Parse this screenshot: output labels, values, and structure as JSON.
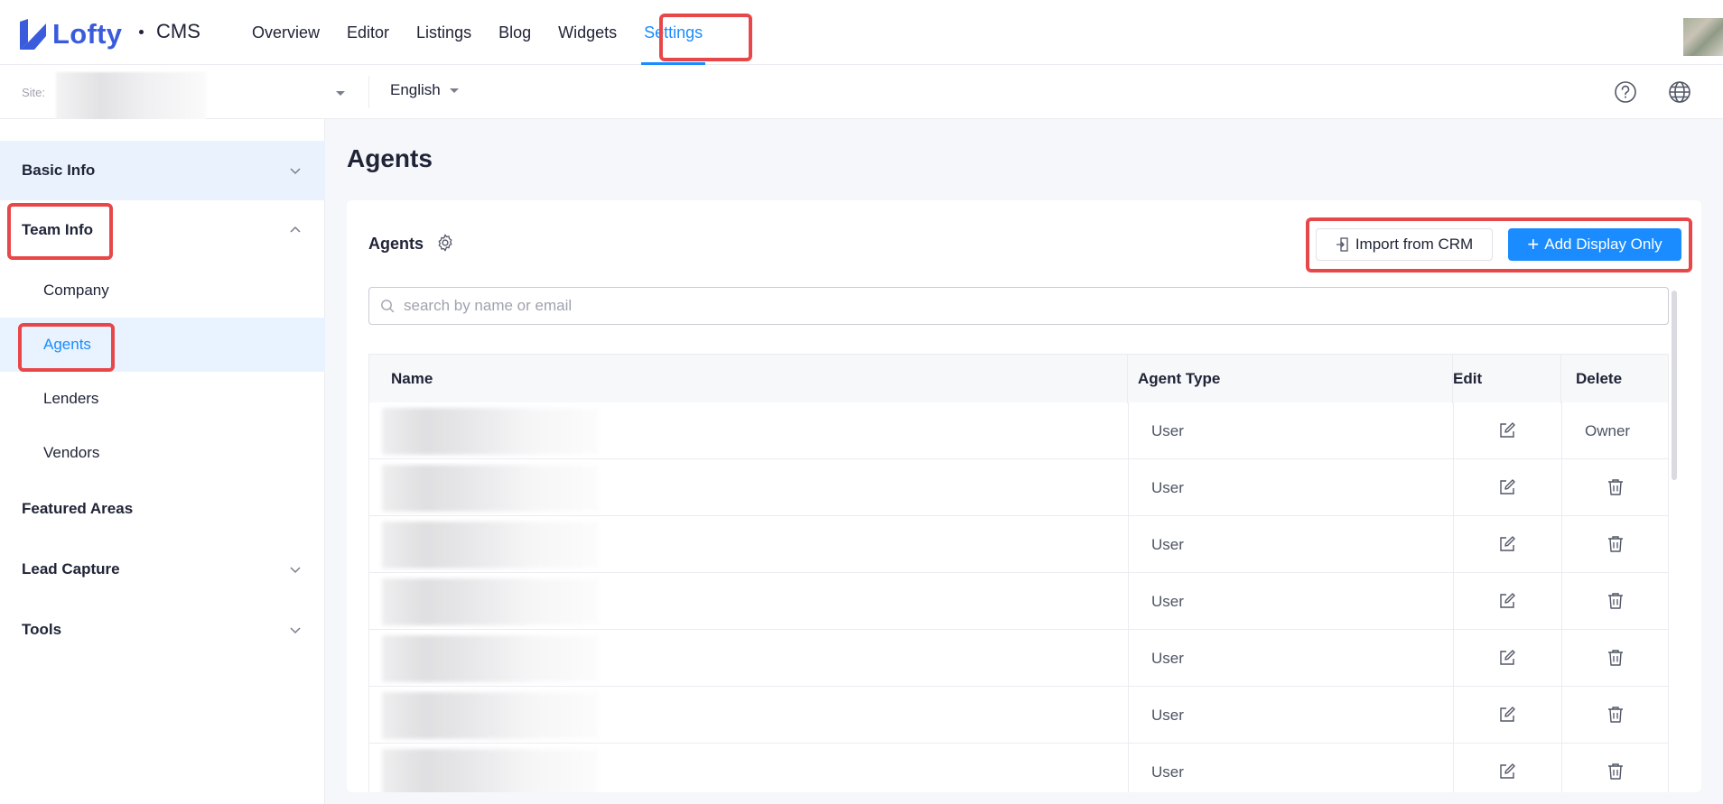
{
  "header": {
    "brand": "Lofty",
    "product": "CMS",
    "nav": [
      {
        "label": "Overview",
        "active": false
      },
      {
        "label": "Editor",
        "active": false
      },
      {
        "label": "Listings",
        "active": false
      },
      {
        "label": "Blog",
        "active": false
      },
      {
        "label": "Widgets",
        "active": false
      },
      {
        "label": "Settings",
        "active": true
      }
    ],
    "brand_color": "#3a5bdc",
    "accent_color": "#1a8cff"
  },
  "subbar": {
    "site_label": "Site:",
    "language": "English",
    "help_icon": "question-circle-icon",
    "globe_icon": "globe-icon"
  },
  "sidebar": {
    "groups": [
      {
        "label": "Basic Info",
        "expanded": false
      },
      {
        "label": "Team Info",
        "expanded": true,
        "items": [
          {
            "label": "Company",
            "active": false
          },
          {
            "label": "Agents",
            "active": true
          },
          {
            "label": "Lenders",
            "active": false
          },
          {
            "label": "Vendors",
            "active": false
          }
        ]
      },
      {
        "label": "Featured Areas"
      },
      {
        "label": "Lead Capture",
        "expanded": false
      },
      {
        "label": "Tools",
        "expanded": false
      }
    ]
  },
  "main": {
    "page_title": "Agents",
    "card_title": "Agents",
    "import_label": "Import from CRM",
    "add_label": "Add Display Only",
    "search_placeholder": "search by name or email",
    "table": {
      "columns": [
        "Name",
        "Agent Type",
        "Edit",
        "Delete"
      ],
      "rows": [
        {
          "type": "User",
          "delete": "Owner"
        },
        {
          "type": "User",
          "delete": "trash-icon"
        },
        {
          "type": "User",
          "delete": "trash-icon"
        },
        {
          "type": "User",
          "delete": "trash-icon"
        },
        {
          "type": "User",
          "delete": "trash-icon"
        },
        {
          "type": "User",
          "delete": "trash-icon"
        },
        {
          "type": "User",
          "delete": "trash-icon"
        }
      ]
    }
  },
  "annotation_color": "#e8474a"
}
